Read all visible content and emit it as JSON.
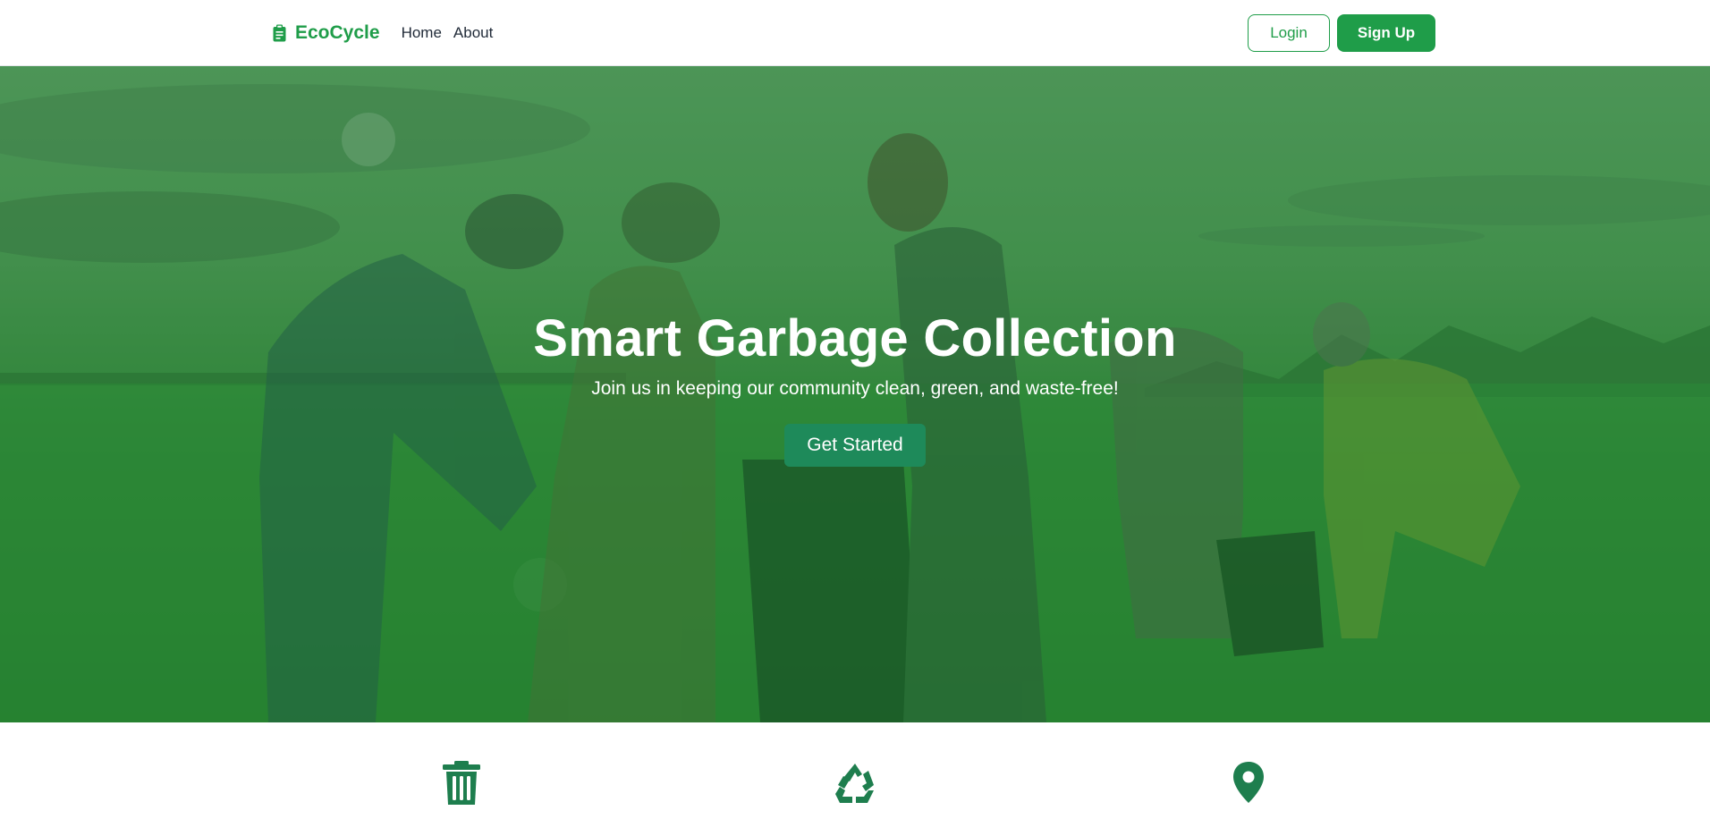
{
  "navbar": {
    "brand": "EcoCycle",
    "links": [
      {
        "label": "Home"
      },
      {
        "label": "About"
      }
    ],
    "login_label": "Login",
    "signup_label": "Sign Up"
  },
  "hero": {
    "title": "Smart Garbage Collection",
    "subtitle": "Join us in keeping our community clean, green, and waste-free!",
    "cta_label": "Get Started"
  },
  "features": {
    "icons": [
      "trash-icon",
      "recycle-icon",
      "map-pin-icon"
    ]
  },
  "colors": {
    "brand": "#1f9d49",
    "cta": "#1e8a5a",
    "feature_icon": "#1e7e4e"
  }
}
